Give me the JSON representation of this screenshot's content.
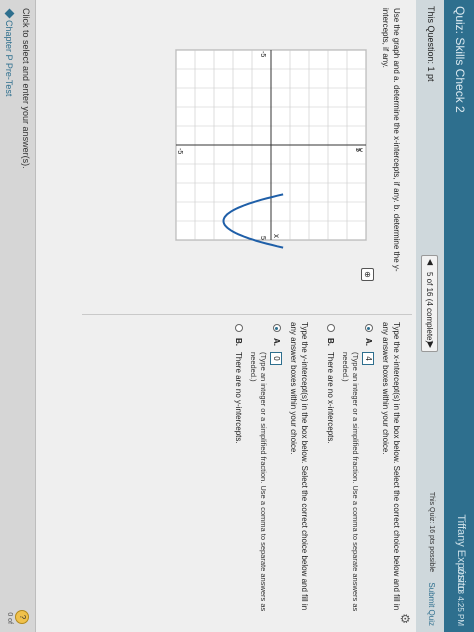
{
  "window": {
    "quiz_title": "Quiz: Skills Check 2",
    "user_name": "Tiffany Expósito",
    "datetime": "2/17/18 4:25 PM"
  },
  "question_bar": {
    "question_label": "This Question: 1 pt",
    "prev_icon": "left-triangle-icon",
    "pager_text": "5 of 16 (4 complete)",
    "next_icon": "right-triangle-icon",
    "quiz_score": "This Quiz: 16 pts possible",
    "submit_label": "Submit Quiz"
  },
  "problem": {
    "instruction": "Use the graph and a. determine the x-intercepts, if any. b. determine the y-intercepts, if any.",
    "expand_icon": "magnify-icon",
    "graph": {
      "x_range": [
        -5,
        5
      ],
      "y_range": [
        -5,
        5
      ],
      "tick_labels": {
        "x_pos": "5",
        "x_neg": "-5",
        "y_pos": "5",
        "y_neg": "-5"
      },
      "axis_x_label": "x",
      "axis_y_label": "y",
      "curve": "parabola-opening-upward",
      "curve_color": "#1f5fa8"
    }
  },
  "answers": {
    "part_a_prompt": "Type the x-intercept(s) in the box below. Select the correct choice below and fill in any answer boxes within your choice.",
    "part_a_choice_a": "A.",
    "part_a_value": "4",
    "part_a_hint": "(Type an integer or a simplified fraction. Use a comma to separate answers as needed.)",
    "part_a_choice_b": "B.",
    "part_a_choice_b_text": "There are no x-intercepts.",
    "part_b_prompt": "Type the y-intercept(s) in the box below. Select the correct choice below and fill in any answer boxes within your choice.",
    "part_b_choice_a": "A.",
    "part_b_value": "0",
    "part_b_hint": "(Type an integer or a simplified fraction. Use a comma to separate answers as needed.)",
    "part_b_choice_b": "B.",
    "part_b_choice_b_text": "There are no y-intercepts."
  },
  "footer": {
    "hint": "Click to select and enter your answer(s).",
    "link": "Chapter P Pre-Test",
    "help_icon": "question-icon",
    "help_text": "?",
    "page": "0 of"
  },
  "colors": {
    "header_bg": "#2e6f8e",
    "accent": "#2e6f8e",
    "help_yellow": "#f0c14b"
  }
}
